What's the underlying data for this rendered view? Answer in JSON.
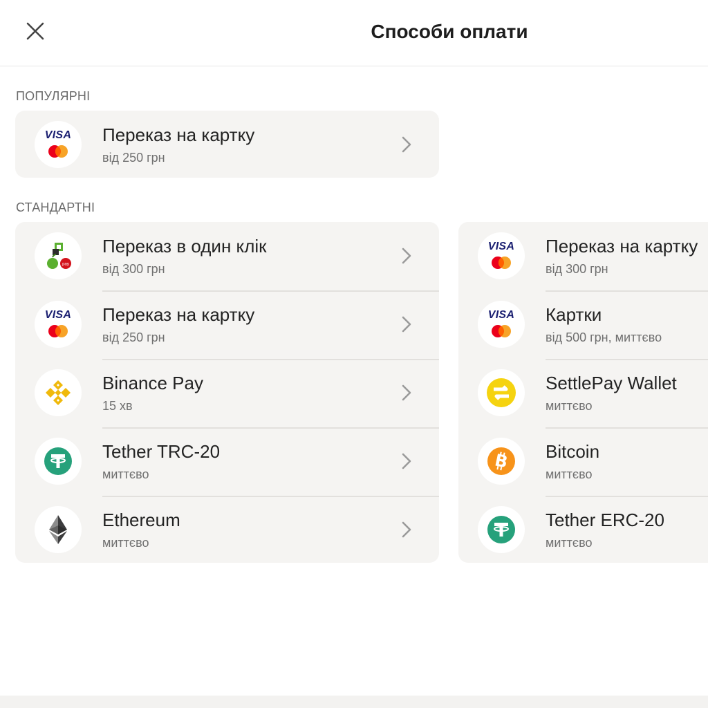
{
  "header": {
    "title": "Способи оплати",
    "close_icon": "close-icon"
  },
  "sections": {
    "popular": {
      "label": "ПОПУЛЯРНІ"
    },
    "standard": {
      "label": "СТАНДАРТНІ"
    }
  },
  "popular": [
    {
      "icon": "visa-mastercard-icon",
      "title": "Переказ на картку",
      "sub": "від 250 грн"
    }
  ],
  "standard_left": [
    {
      "icon": "privat-icon",
      "title": "Переказ в один клік",
      "sub": "від 300 грн"
    },
    {
      "icon": "visa-mastercard-icon",
      "title": "Переказ на картку",
      "sub": "від 250 грн"
    },
    {
      "icon": "binance-icon",
      "title": "Binance Pay",
      "sub": "15 хв"
    },
    {
      "icon": "tether-icon",
      "title": "Tether TRC-20",
      "sub": "миттєво"
    },
    {
      "icon": "ethereum-icon",
      "title": "Ethereum",
      "sub": "миттєво"
    }
  ],
  "standard_right": [
    {
      "icon": "visa-mastercard-icon",
      "title": "Переказ на картку",
      "sub": "від 300 грн"
    },
    {
      "icon": "visa-mastercard-icon",
      "title": "Картки",
      "sub": "від 500 грн, миттєво"
    },
    {
      "icon": "settlepay-icon",
      "title": "SettlePay Wallet",
      "sub": "миттєво"
    },
    {
      "icon": "bitcoin-icon",
      "title": "Bitcoin",
      "sub": "миттєво"
    },
    {
      "icon": "tether-icon",
      "title": "Tether ERC-20",
      "sub": "миттєво"
    }
  ],
  "colors": {
    "card_bg": "#f5f4f2",
    "visa_blue": "#1a1f71",
    "mc_red": "#eb001b",
    "mc_orange": "#f79e1b",
    "binance_yellow": "#f0b90b",
    "tether_green": "#26a17b",
    "bitcoin_orange": "#f7931a",
    "settlepay_yellow": "#f5d310",
    "privat_green": "#5bb030"
  }
}
